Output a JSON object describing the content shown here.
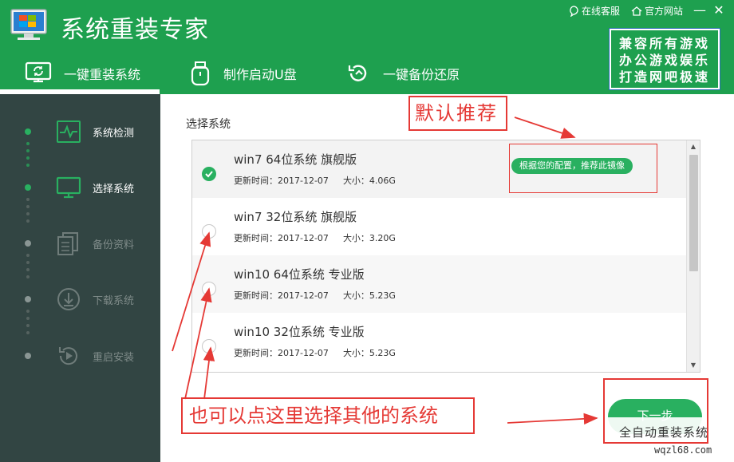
{
  "app": {
    "title": "系统重装专家",
    "top_links": [
      "在线客服",
      "官方网站"
    ],
    "window_controls": {
      "minimize": "—",
      "close": "✕"
    }
  },
  "promo": {
    "lines": [
      "兼容所有游戏",
      "办公游戏娱乐",
      "打造网吧极速"
    ]
  },
  "nav": {
    "tabs": [
      {
        "label": "一键重装系统",
        "icon": "monitor-refresh-icon",
        "active": true
      },
      {
        "label": "制作启动U盘",
        "icon": "usb-drive-icon",
        "active": false
      },
      {
        "label": "一键备份还原",
        "icon": "backup-restore-icon",
        "active": false
      }
    ]
  },
  "sidebar": {
    "steps": [
      {
        "label": "系统检测",
        "icon": "pulse-monitor-icon",
        "active": true
      },
      {
        "label": "选择系统",
        "icon": "desktop-icon",
        "active": true
      },
      {
        "label": "备份资料",
        "icon": "documents-icon",
        "active": false
      },
      {
        "label": "下载系统",
        "icon": "download-icon",
        "active": false
      },
      {
        "label": "重启安装",
        "icon": "restart-icon",
        "active": false
      }
    ]
  },
  "main": {
    "heading": "选择系统",
    "systems": [
      {
        "name": "win7 64位系统 旗舰版",
        "updated": "更新时间：2017-12-07",
        "size": "大小：4.06G",
        "selected": true,
        "badge": "根据您的配置，推荐此镜像"
      },
      {
        "name": "win7 32位系统 旗舰版",
        "updated": "更新时间：2017-12-07",
        "size": "大小：3.20G",
        "selected": false
      },
      {
        "name": "win10 64位系统 专业版",
        "updated": "更新时间：2017-12-07",
        "size": "大小：5.23G",
        "selected": false
      },
      {
        "name": "win10 32位系统 专业版",
        "updated": "更新时间：2017-12-07",
        "size": "大小：5.23G",
        "selected": false
      }
    ],
    "next_button": "下一步"
  },
  "annotations": {
    "recommend": "默认推荐",
    "other": "也可以点这里选择其他的系统"
  },
  "watermark": {
    "line1": "全自动重装系统",
    "line2": "wqzl68.com"
  },
  "colors": {
    "brand_green": "#1ea04f",
    "accent_green": "#29b060",
    "sidebar_bg": "#324543",
    "annotation_red": "#e53935"
  }
}
